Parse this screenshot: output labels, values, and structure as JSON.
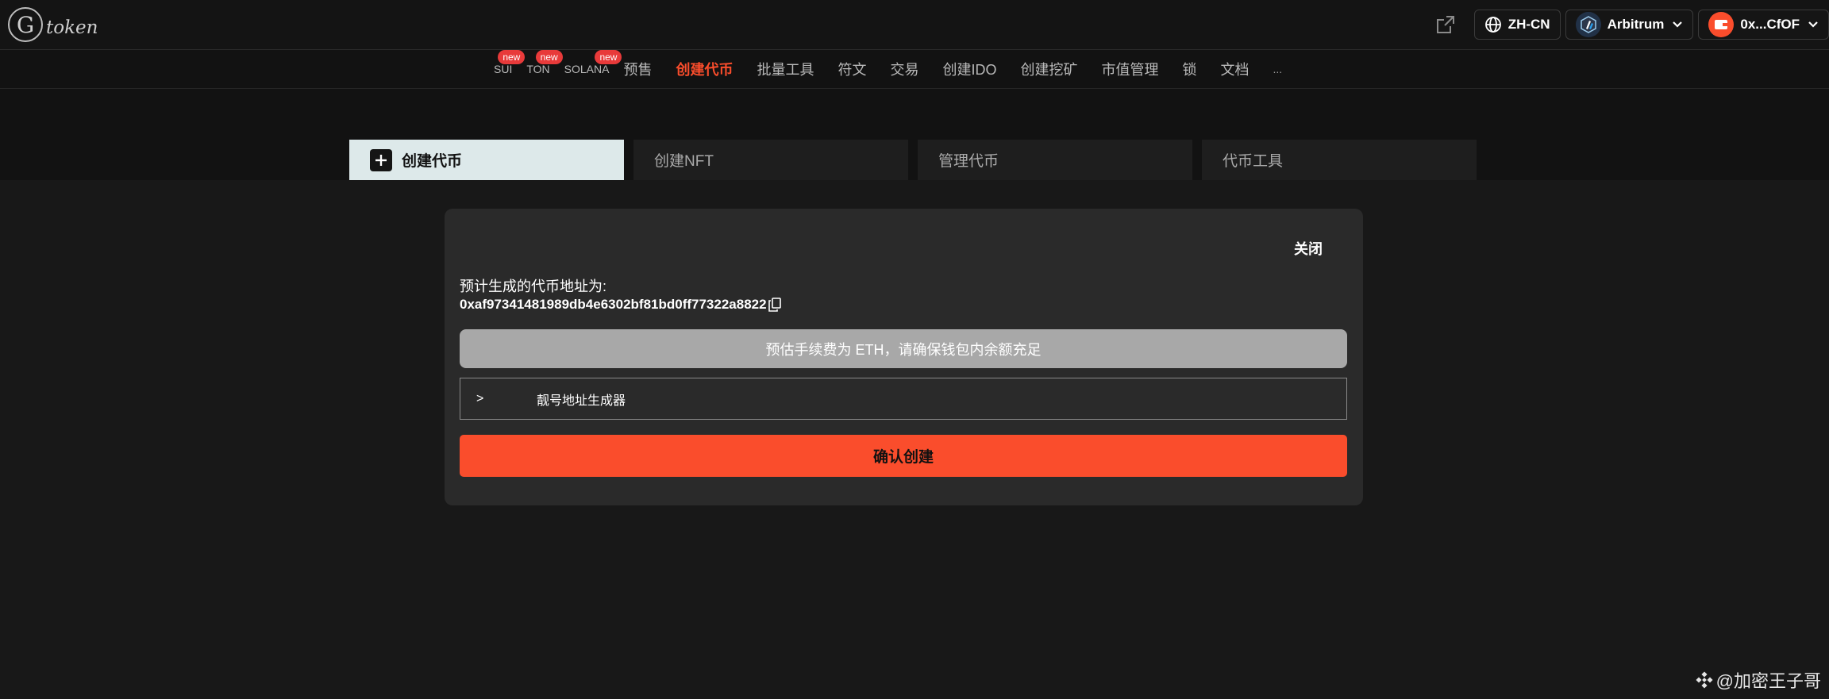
{
  "brand": {
    "logo_letter": "G",
    "logo_text": "token"
  },
  "header": {
    "language": "ZH-CN",
    "network": "Arbitrum",
    "wallet": "0x...CfOF"
  },
  "nav": {
    "items": [
      {
        "label": "SUI",
        "badge": "new"
      },
      {
        "label": "TON",
        "badge": "new"
      },
      {
        "label": "SOLANA",
        "badge": "new"
      },
      {
        "label": "预售"
      },
      {
        "label": "创建代币",
        "active": true
      },
      {
        "label": "批量工具"
      },
      {
        "label": "符文"
      },
      {
        "label": "交易"
      },
      {
        "label": "创建IDO"
      },
      {
        "label": "创建挖矿"
      },
      {
        "label": "市值管理"
      },
      {
        "label": "锁"
      },
      {
        "label": "文档"
      },
      {
        "label": "..."
      }
    ]
  },
  "tabs": [
    {
      "label": "创建代币",
      "active": true
    },
    {
      "label": "创建NFT"
    },
    {
      "label": "管理代币"
    },
    {
      "label": "代币工具"
    }
  ],
  "modal": {
    "close_label": "关闭",
    "address_label": "预计生成的代币地址为:",
    "address_value": "0xaf97341481989db4e6302bf81bd0ff77322a8822",
    "fee_notice": "预估手续费为 ETH，请确保钱包内余额充足",
    "vanity_arrow": ">",
    "vanity_label": "靓号地址生成器",
    "confirm_label": "确认创建"
  },
  "watermark": "@加密王子哥",
  "colors": {
    "accent": "#fa4d2c",
    "active_tab_bg": "#dde9ea",
    "background": "#181818",
    "fee_bar": "#a8a8a8"
  }
}
